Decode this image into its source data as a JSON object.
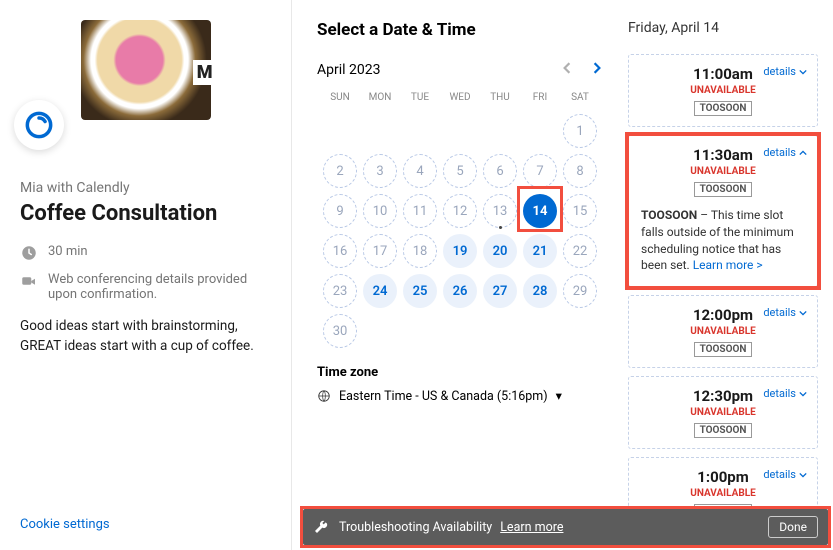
{
  "left": {
    "host": "Mia with Calendly",
    "title": "Coffee Consultation",
    "duration": "30 min",
    "location": "Web conferencing details provided upon confirmation.",
    "description": "Good ideas start with brainstorming, GREAT ideas start with a cup of coffee.",
    "cookie": "Cookie settings"
  },
  "calendar": {
    "heading": "Select a Date & Time",
    "month": "April 2023",
    "dow": [
      "SUN",
      "MON",
      "TUE",
      "WED",
      "THU",
      "FRI",
      "SAT"
    ],
    "weeks": [
      [
        null,
        null,
        null,
        null,
        null,
        null,
        {
          "d": 1
        }
      ],
      [
        {
          "d": 2
        },
        {
          "d": 3
        },
        {
          "d": 4
        },
        {
          "d": 5
        },
        {
          "d": 6
        },
        {
          "d": 7
        },
        {
          "d": 8
        }
      ],
      [
        {
          "d": 9
        },
        {
          "d": 10
        },
        {
          "d": 11
        },
        {
          "d": 12
        },
        {
          "d": 13,
          "today": true
        },
        {
          "d": 14,
          "selected": true
        },
        {
          "d": 15
        }
      ],
      [
        {
          "d": 16
        },
        {
          "d": 17
        },
        {
          "d": 18
        },
        {
          "d": 19,
          "avail": true
        },
        {
          "d": 20,
          "avail": true
        },
        {
          "d": 21,
          "avail": true
        },
        {
          "d": 22
        }
      ],
      [
        {
          "d": 23
        },
        {
          "d": 24,
          "avail": true
        },
        {
          "d": 25,
          "avail": true
        },
        {
          "d": 26,
          "avail": true
        },
        {
          "d": 27,
          "avail": true
        },
        {
          "d": 28,
          "avail": true
        },
        {
          "d": 29
        }
      ],
      [
        {
          "d": 30
        },
        null,
        null,
        null,
        null,
        null,
        null
      ]
    ],
    "tz_label": "Time zone",
    "tz_value": "Eastern Time - US & Canada (5:16pm)"
  },
  "slots": {
    "date_label": "Friday, April 14",
    "details_label": "details",
    "items": [
      {
        "time": "11:00am",
        "status": "UNAVAILABLE",
        "tag": "TOOSOON"
      },
      {
        "time": "11:30am",
        "status": "UNAVAILABLE",
        "tag": "TOOSOON",
        "expanded": true,
        "highlighted": true,
        "explanation_prefix": "TOOSOON",
        "explanation_text": " – This time slot falls outside of the minimum scheduling notice that has been set. ",
        "learn_more": "Learn more >"
      },
      {
        "time": "12:00pm",
        "status": "UNAVAILABLE",
        "tag": "TOOSOON"
      },
      {
        "time": "12:30pm",
        "status": "UNAVAILABLE",
        "tag": "TOOSOON"
      },
      {
        "time": "1:00pm",
        "status": "UNAVAILABLE",
        "tag": "TOOSOON"
      }
    ]
  },
  "bar": {
    "text": "Troubleshooting Availability",
    "learn": "Learn more",
    "done": "Done"
  }
}
